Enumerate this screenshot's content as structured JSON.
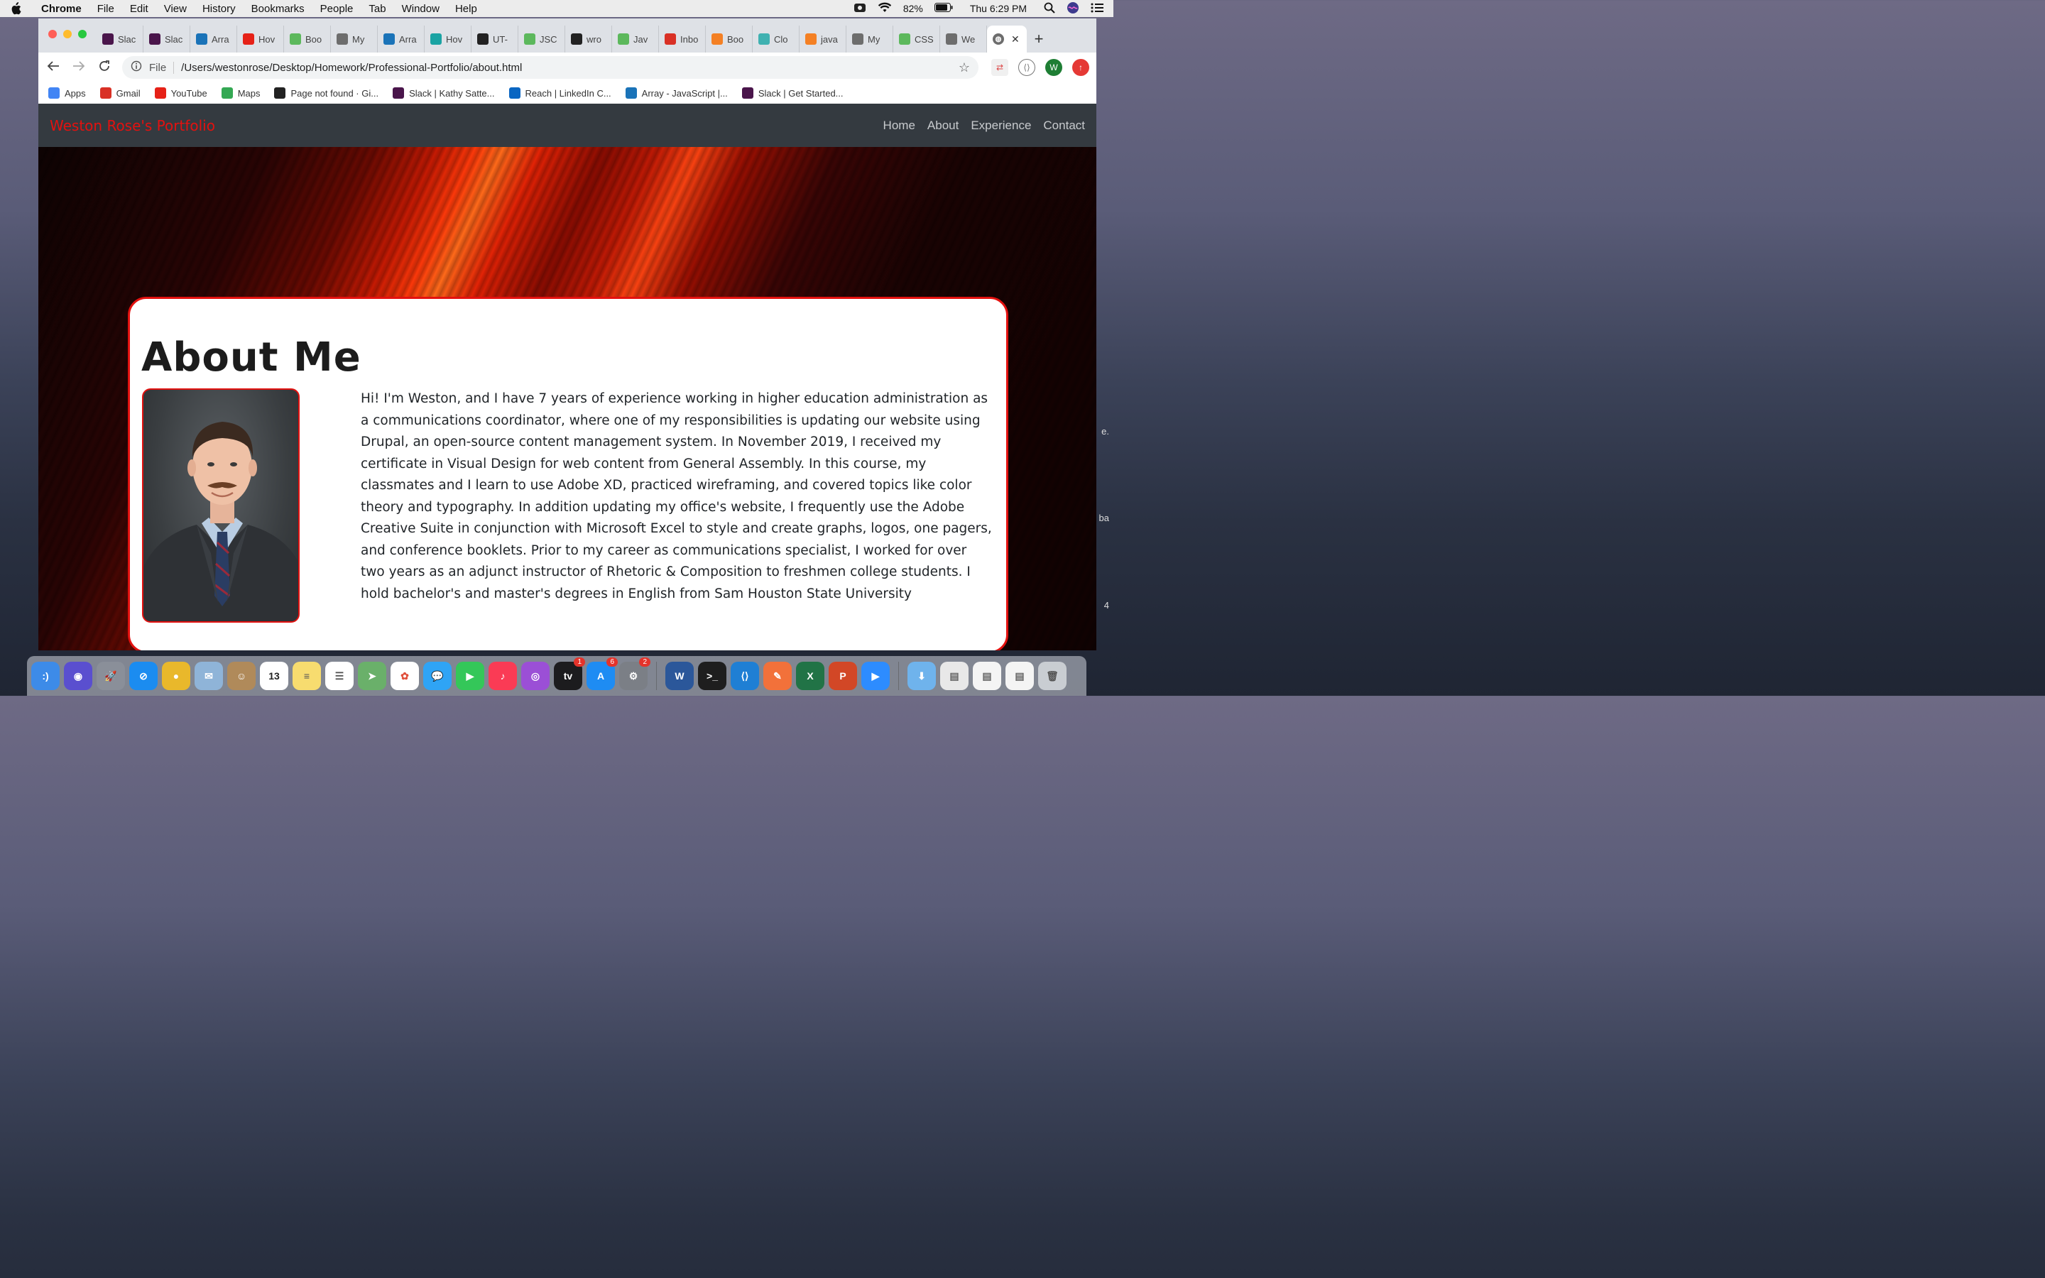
{
  "menubar": {
    "app_name": "Chrome",
    "items": [
      "File",
      "Edit",
      "View",
      "History",
      "Bookmarks",
      "People",
      "Tab",
      "Window",
      "Help"
    ],
    "battery": "82%",
    "clock": "Thu 6:29 PM"
  },
  "browser": {
    "tabs": [
      {
        "label": "Slac",
        "icon_color": "#4a154b",
        "icon": "slack-icon"
      },
      {
        "label": "Slac",
        "icon_color": "#4a154b",
        "icon": "slack-icon"
      },
      {
        "label": "Arra",
        "icon_color": "#1a73b8",
        "icon": "mdn-icon"
      },
      {
        "label": "Hov",
        "icon_color": "#e62117",
        "icon": "youtube-icon"
      },
      {
        "label": "Boo",
        "icon_color": "#5cb85c",
        "icon": "w3schools-icon"
      },
      {
        "label": "My",
        "icon_color": "#6d6d6d",
        "icon": "globe-icon"
      },
      {
        "label": "Arra",
        "icon_color": "#1a73b8",
        "icon": "mdn-icon"
      },
      {
        "label": "Hov",
        "icon_color": "#1aa3a3",
        "icon": "code-icon"
      },
      {
        "label": "UT-",
        "icon_color": "#222222",
        "icon": "github-icon"
      },
      {
        "label": "JSC",
        "icon_color": "#5cb85c",
        "icon": "w3schools-icon"
      },
      {
        "label": "wro",
        "icon_color": "#222222",
        "icon": "github-icon"
      },
      {
        "label": "Jav",
        "icon_color": "#5cb85c",
        "icon": "w3schools-icon"
      },
      {
        "label": "Inbo",
        "icon_color": "#d93025",
        "icon": "gmail-icon"
      },
      {
        "label": "Boo",
        "icon_color": "#f48024",
        "icon": "stackoverflow-icon"
      },
      {
        "label": "Clo",
        "icon_color": "#3fb1b1",
        "icon": "docs-icon"
      },
      {
        "label": "java",
        "icon_color": "#f48024",
        "icon": "stackoverflow-icon"
      },
      {
        "label": "My",
        "icon_color": "#6d6d6d",
        "icon": "globe-icon"
      },
      {
        "label": "CSS",
        "icon_color": "#5cb85c",
        "icon": "w3schools-icon"
      },
      {
        "label": "We",
        "icon_color": "#6d6d6d",
        "icon": "globe-icon"
      }
    ],
    "active_tab": {
      "icon": "globe-icon",
      "close": "✕"
    },
    "new_tab": "+",
    "address": {
      "scheme": "File",
      "path": "/Users/westonrose/Desktop/Homework/Professional-Portfolio/about.html"
    },
    "profile_initial": "W",
    "bookmarks": [
      {
        "label": "Apps",
        "icon": "apps-grid-icon",
        "color": "#4285f4"
      },
      {
        "label": "Gmail",
        "icon": "gmail-icon",
        "color": "#d93025"
      },
      {
        "label": "YouTube",
        "icon": "youtube-icon",
        "color": "#e62117"
      },
      {
        "label": "Maps",
        "icon": "maps-icon",
        "color": "#34a853"
      },
      {
        "label": "Page not found · Gi...",
        "icon": "github-icon",
        "color": "#222222"
      },
      {
        "label": "Slack | Kathy Satte...",
        "icon": "slack-icon",
        "color": "#4a154b"
      },
      {
        "label": "Reach | LinkedIn C...",
        "icon": "linkedin-icon",
        "color": "#0a66c2"
      },
      {
        "label": "Array - JavaScript |...",
        "icon": "mdn-icon",
        "color": "#1a73b8"
      },
      {
        "label": "Slack | Get Started...",
        "icon": "slack-icon",
        "color": "#4a154b"
      }
    ]
  },
  "site": {
    "brand": "Weston Rose's Portfolio",
    "brand_color": "#e3110f",
    "nav": [
      "Home",
      "About",
      "Experience",
      "Contact"
    ],
    "heading": "About Me",
    "photo_alt": "Headshot of Weston Rose",
    "bio": "Hi! I'm Weston, and I have 7 years of experience working in higher education administration as a communications coordinator, where one of my responsibilities is updating our website using Drupal, an open-source content management system. In November 2019, I received my certificate in Visual Design for web content from General Assembly. In this course, my classmates and I learn to use Adobe XD, practiced wireframing, and covered topics like color theory and typography. In addition updating my office's website, I frequently use the Adobe Creative Suite in conjunction with Microsoft Excel to style and create graphs, logos, one pagers, and conference booklets. Prior to my career as communications specialist, I worked for over two years as an adjunct instructor of Rhetoric & Composition to freshmen college students. I hold bachelor's and master's degrees in English from Sam Houston State University"
  },
  "desktop_edge": [
    "e.",
    "ba",
    "4"
  ],
  "dock": [
    {
      "name": "finder-icon",
      "color": "#3d8be8",
      "glyph": ":)"
    },
    {
      "name": "siri-icon",
      "color": "#5a4fcf",
      "glyph": "◉"
    },
    {
      "name": "launchpad-icon",
      "color": "#8a8f99",
      "glyph": "🚀"
    },
    {
      "name": "safari-icon",
      "color": "#1b8cf0",
      "glyph": "⊘"
    },
    {
      "name": "chrome-icon",
      "color": "#e9b82b",
      "glyph": "●"
    },
    {
      "name": "mail-icon",
      "color": "#8fb4d8",
      "glyph": "✉"
    },
    {
      "name": "contacts-icon",
      "color": "#b08a5a",
      "glyph": "☺"
    },
    {
      "name": "calendar-icon",
      "color": "#ffffff",
      "glyph": "13",
      "label_color": "#222"
    },
    {
      "name": "notes-icon",
      "color": "#f7dc6f",
      "glyph": "≡",
      "label_color": "#555"
    },
    {
      "name": "reminders-icon",
      "color": "#ffffff",
      "glyph": "☰",
      "label_color": "#555"
    },
    {
      "name": "maps-app-icon",
      "color": "#6ab06a",
      "glyph": "➤"
    },
    {
      "name": "photos-icon",
      "color": "#ffffff",
      "glyph": "✿",
      "label_color": "#e0503c"
    },
    {
      "name": "messages-icon",
      "color": "#2fa4f5",
      "glyph": "💬"
    },
    {
      "name": "facetime-icon",
      "color": "#34c759",
      "glyph": "▶"
    },
    {
      "name": "music-icon",
      "color": "#fa3b55",
      "glyph": "♪"
    },
    {
      "name": "podcasts-icon",
      "color": "#9b4fd6",
      "glyph": "◎"
    },
    {
      "name": "apple-tv-icon",
      "color": "#1c1c1e",
      "glyph": "tv",
      "badge": "1"
    },
    {
      "name": "app-store-icon",
      "color": "#1e8cf3",
      "glyph": "A",
      "badge": "6"
    },
    {
      "name": "system-preferences-icon",
      "color": "#7b7f86",
      "glyph": "⚙",
      "badge": "2"
    },
    {
      "name": "word-icon",
      "color": "#2b579a",
      "glyph": "W"
    },
    {
      "name": "terminal-icon",
      "color": "#1e1e1e",
      "glyph": ">_"
    },
    {
      "name": "vscode-icon",
      "color": "#1f7fd4",
      "glyph": "⟨⟩"
    },
    {
      "name": "postman-icon",
      "color": "#f2713a",
      "glyph": "✎"
    },
    {
      "name": "excel-icon",
      "color": "#217346",
      "glyph": "X"
    },
    {
      "name": "powerpoint-icon",
      "color": "#d24726",
      "glyph": "P"
    },
    {
      "name": "zoom-icon",
      "color": "#2d8cff",
      "glyph": "▶"
    },
    {
      "name": "downloads-folder-icon",
      "color": "#6fb3ec",
      "glyph": "⬇"
    },
    {
      "name": "recent-doc-1-icon",
      "color": "#e8e8e8",
      "glyph": "▤",
      "label_color": "#666"
    },
    {
      "name": "recent-doc-2-icon",
      "color": "#f4f4f4",
      "glyph": "▤",
      "label_color": "#666"
    },
    {
      "name": "recent-doc-3-icon",
      "color": "#f4f4f4",
      "glyph": "▤",
      "label_color": "#666"
    },
    {
      "name": "trash-icon",
      "color": "#c9cdd2",
      "glyph": "🗑",
      "label_color": "#555"
    }
  ]
}
